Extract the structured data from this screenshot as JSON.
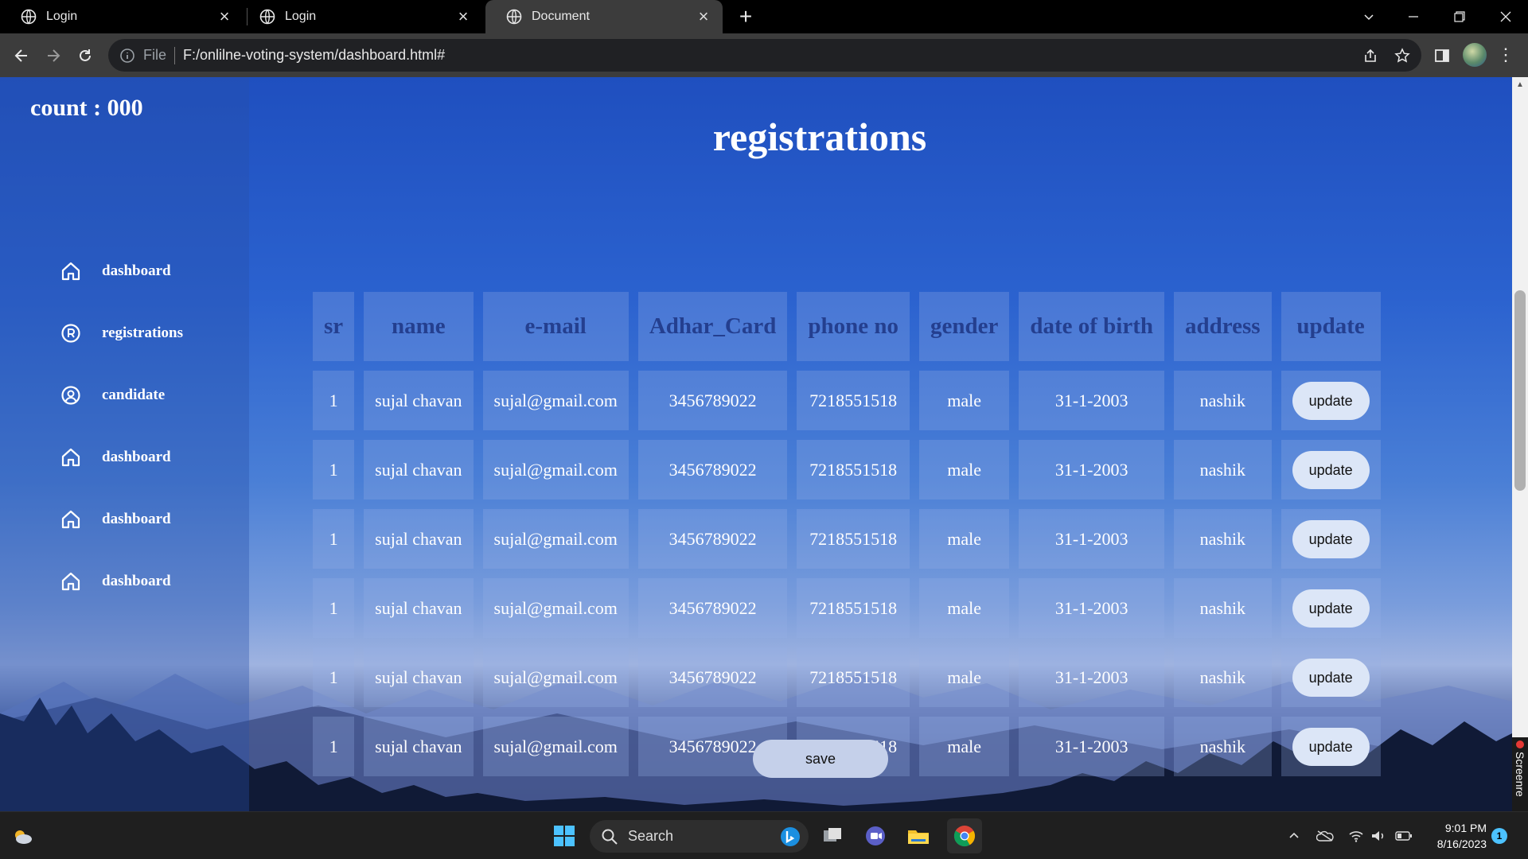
{
  "browser": {
    "tabs": [
      {
        "title": "Login",
        "active": false
      },
      {
        "title": "Login",
        "active": false
      },
      {
        "title": "Document",
        "active": true
      }
    ],
    "file_label": "File",
    "url": "F:/onlilne-voting-system/dashboard.html#"
  },
  "page": {
    "count_label": "count : 000",
    "title": "registrations",
    "nav": [
      {
        "label": "dashboard",
        "icon": "home-icon"
      },
      {
        "label": "registrations",
        "icon": "registered-icon"
      },
      {
        "label": "candidate",
        "icon": "user-circle-icon"
      },
      {
        "label": "dashboard",
        "icon": "home-icon"
      },
      {
        "label": "dashboard",
        "icon": "home-icon"
      },
      {
        "label": "dashboard",
        "icon": "home-icon"
      }
    ],
    "table": {
      "headers": [
        "sr",
        "name",
        "e-mail",
        "Adhar_Card",
        "phone no",
        "gender",
        "date of birth",
        "address",
        "update"
      ],
      "rows": [
        {
          "sr": "1",
          "name": "sujal chavan",
          "email": "sujal@gmail.com",
          "adhar": "3456789022",
          "phone": "7218551518",
          "gender": "male",
          "dob": "31-1-2003",
          "address": "nashik",
          "update": "update"
        },
        {
          "sr": "1",
          "name": "sujal chavan",
          "email": "sujal@gmail.com",
          "adhar": "3456789022",
          "phone": "7218551518",
          "gender": "male",
          "dob": "31-1-2003",
          "address": "nashik",
          "update": "update"
        },
        {
          "sr": "1",
          "name": "sujal chavan",
          "email": "sujal@gmail.com",
          "adhar": "3456789022",
          "phone": "7218551518",
          "gender": "male",
          "dob": "31-1-2003",
          "address": "nashik",
          "update": "update"
        },
        {
          "sr": "1",
          "name": "sujal chavan",
          "email": "sujal@gmail.com",
          "adhar": "3456789022",
          "phone": "7218551518",
          "gender": "male",
          "dob": "31-1-2003",
          "address": "nashik",
          "update": "update"
        },
        {
          "sr": "1",
          "name": "sujal chavan",
          "email": "sujal@gmail.com",
          "adhar": "3456789022",
          "phone": "7218551518",
          "gender": "male",
          "dob": "31-1-2003",
          "address": "nashik",
          "update": "update"
        },
        {
          "sr": "1",
          "name": "sujal chavan",
          "email": "sujal@gmail.com",
          "adhar": "3456789022",
          "phone": "7218551518",
          "gender": "male",
          "dob": "31-1-2003",
          "address": "nashik",
          "update": "update"
        }
      ]
    },
    "save_label": "save",
    "recorder_label": "Screenre"
  },
  "taskbar": {
    "search_label": "Search",
    "time": "9:01 PM",
    "date": "8/16/2023",
    "notification_count": "1"
  },
  "colors": {
    "page_top": "#1f4fbf",
    "header_text": "#243f8f",
    "cell_bg": "rgba(150,175,230,0.28)",
    "button_bg": "#dce6f7"
  }
}
